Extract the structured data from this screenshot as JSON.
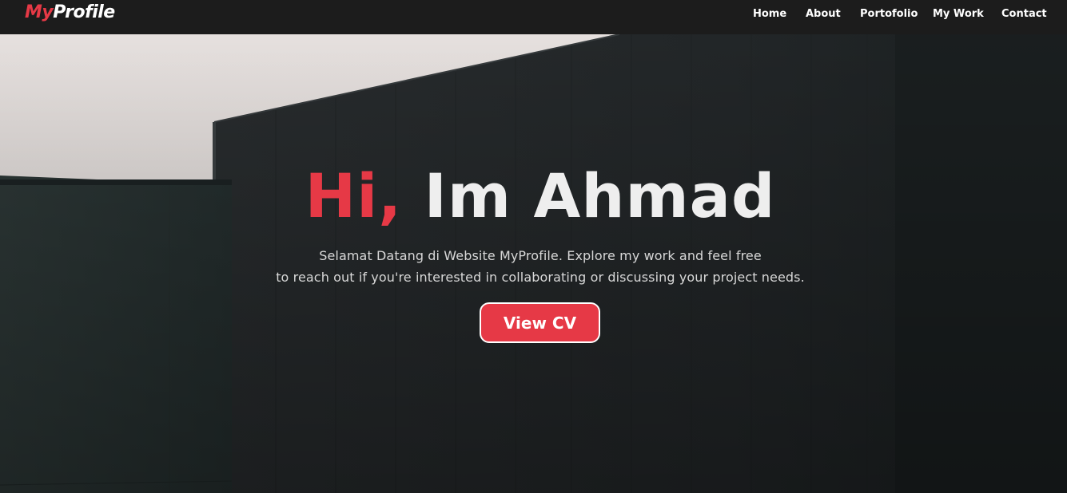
{
  "brand": {
    "prefix": "My",
    "suffix": "Profile"
  },
  "nav": {
    "items": [
      {
        "label": "Home"
      },
      {
        "label": "About"
      },
      {
        "label": "Portofolio"
      },
      {
        "label": "My Work"
      },
      {
        "label": "Contact"
      }
    ]
  },
  "hero": {
    "greeting": "Hi,",
    "name": " Im Ahmad",
    "subtitle_line1": "Selamat Datang di Website MyProfile. Explore my work and feel free",
    "subtitle_line2": "to reach out if you're interested in collaborating or discussing your project needs.",
    "cta_label": "View CV",
    "background": "architecture-building-photo"
  },
  "colors": {
    "accent": "#e63946",
    "navbar": "#1c1c1c",
    "text": "#ffffff"
  }
}
